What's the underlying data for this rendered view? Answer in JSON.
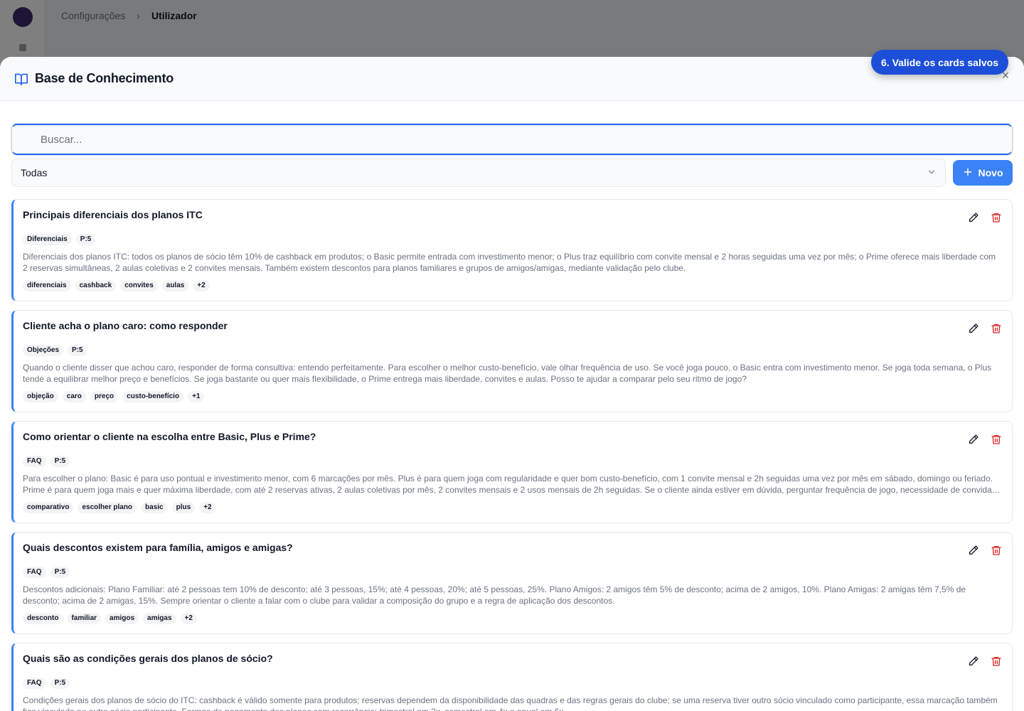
{
  "background": {
    "breadcrumb": [
      "Configurações",
      "Utilizador"
    ],
    "separator": "›"
  },
  "modal": {
    "title": "Base de Conhecimento",
    "close_label": "×"
  },
  "tour": {
    "tip": "6. Valide os cards salvos"
  },
  "search": {
    "placeholder": "Buscar..."
  },
  "filter": {
    "selected": "Todas"
  },
  "new_button": {
    "label": "Novo"
  },
  "cards": [
    {
      "title": "Principais diferenciais dos planos ITC",
      "category": "Diferenciais",
      "priority": "P:5",
      "text": "Diferenciais dos planos ITC: todos os planos de sócio têm 10% de cashback em produtos; o Basic permite entrada com investimento menor; o Plus traz equilíbrio com convite mensal e 2 horas seguidas uma vez por mês; o Prime oferece mais liberdade com 2 reservas simultâneas, 2 aulas coletivas e 2 convites mensais. Também existem descontos para planos familiares e grupos de amigos/amigas, mediante validação pelo clube.",
      "tags": [
        "diferenciais",
        "cashback",
        "convites",
        "aulas",
        "+2"
      ]
    },
    {
      "title": "Cliente acha o plano caro: como responder",
      "category": "Objeções",
      "priority": "P:5",
      "text": "Quando o cliente disser que achou caro, responder de forma consultiva: entendo perfeitamente. Para escolher o melhor custo-benefício, vale olhar frequência de uso. Se você joga pouco, o Basic entra com investimento menor. Se joga toda semana, o Plus tende a equilibrar melhor preço e benefícios. Se joga bastante ou quer mais flexibilidade, o Prime entrega mais liberdade, convites e aulas. Posso te ajudar a comparar pelo seu ritmo de jogo?",
      "tags": [
        "objeção",
        "caro",
        "preço",
        "custo-benefício",
        "+1"
      ]
    },
    {
      "title": "Como orientar o cliente na escolha entre Basic, Plus e Prime?",
      "category": "FAQ",
      "priority": "P:5",
      "text": "Para escolher o plano: Basic é para uso pontual e investimento menor, com 6 marcações por mês. Plus é para quem joga com regularidade e quer bom custo-benefício, com 1 convite mensal e 2h seguidas uma vez por mês em sábado, domingo ou feriado. Prime é para quem joga mais e quer máxima liberdade, com até 2 reservas ativas, 2 aulas coletivas por mês, 2 convites mensais e 2 usos mensais de 2h seguidas. Se o cliente ainda estiver em dúvida, perguntar frequência de jogo, necessidade de convidar não sócio e...",
      "tags": [
        "comparativo",
        "escolher plano",
        "basic",
        "plus",
        "+2"
      ]
    },
    {
      "title": "Quais descontos existem para família, amigos e amigas?",
      "category": "FAQ",
      "priority": "P:5",
      "text": "Descontos adicionais: Plano Familiar: até 2 pessoas tem 10% de desconto; até 3 pessoas, 15%; até 4 pessoas, 20%; até 5 pessoas, 25%. Plano Amigos: 2 amigos têm 5% de desconto; acima de 2 amigos, 10%. Plano Amigas: 2 amigas têm 7,5% de desconto; acima de 2 amigas, 15%. Sempre orientar o cliente a falar com o clube para validar a composição do grupo e a regra de aplicação dos descontos.",
      "tags": [
        "desconto",
        "familiar",
        "amigos",
        "amigas",
        "+2"
      ]
    },
    {
      "title": "Quais são as condições gerais dos planos de sócio?",
      "category": "FAQ",
      "priority": "P:5",
      "text": "Condições gerais dos planos de sócio do ITC: cashback é válido somente para produtos; reservas dependem da disponibilidade das quadras e das regras gerais do clube; se uma reserva tiver outro sócio vinculado como participante, essa marcação também fica vinculada ao outro sócio participante. Formas de pagamento dos planos com recorrência: trimestral em 3x, semestral em 4x e anual em 6x.",
      "tags": []
    }
  ],
  "colors": {
    "accent": "#3b82f6",
    "delete": "#dc2626",
    "tour": "#1d4ed8"
  }
}
